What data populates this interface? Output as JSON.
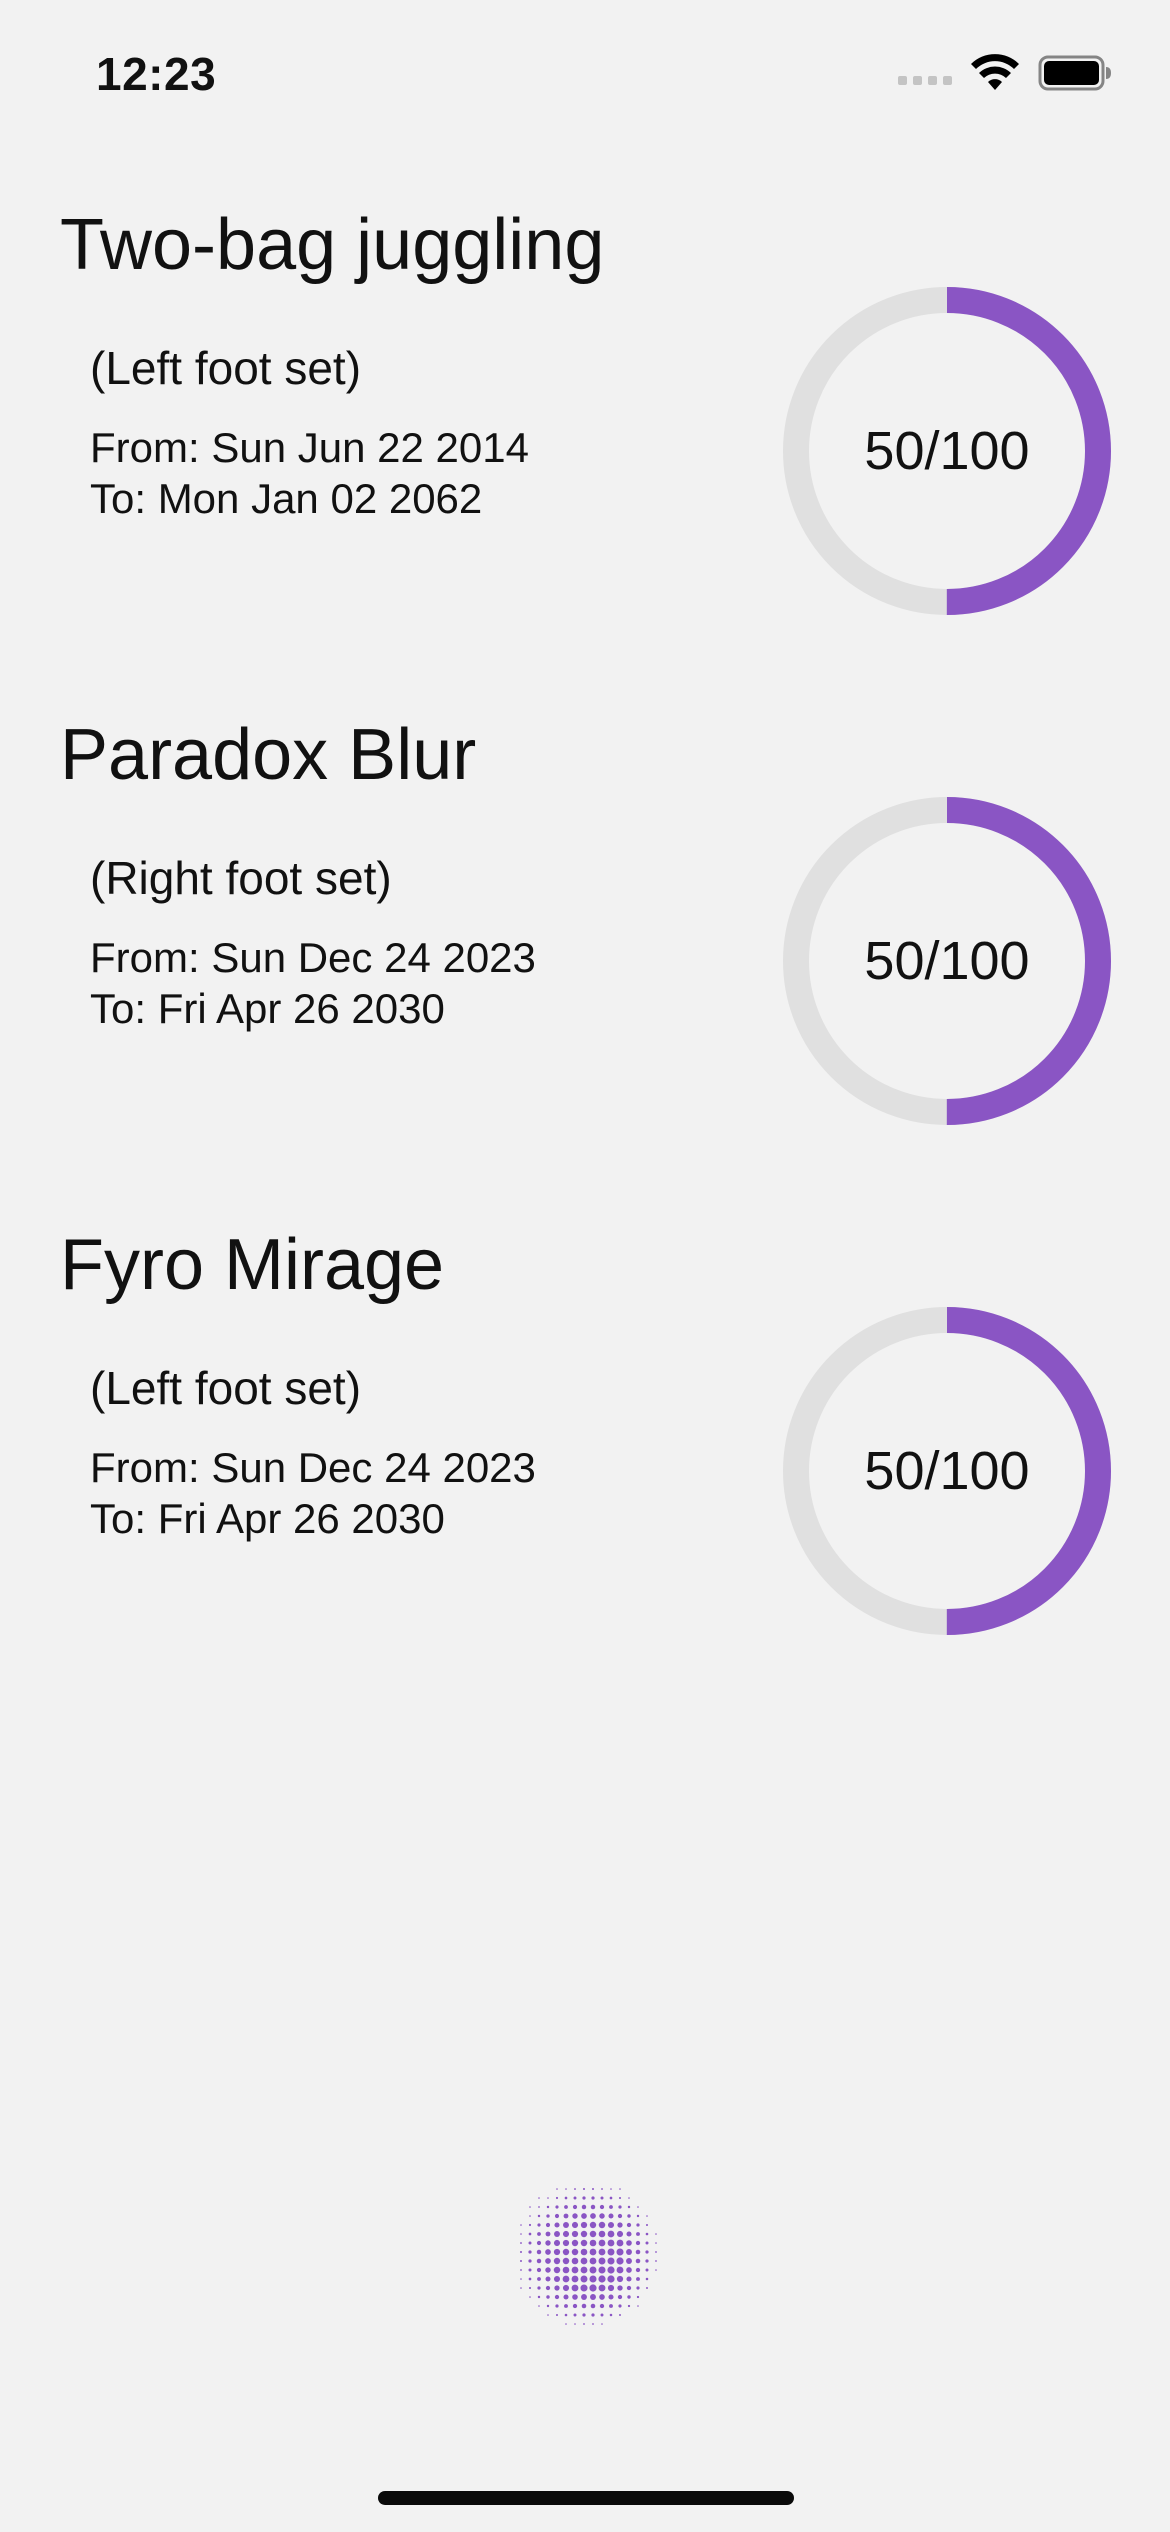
{
  "status_bar": {
    "time": "12:23",
    "icons": [
      "cellular-signal-icon",
      "wifi-icon",
      "battery-icon"
    ]
  },
  "colors": {
    "accent": "#8a55c4",
    "ring_track": "#e0e0e0",
    "background": "#f2f2f2"
  },
  "cards": [
    {
      "title": "Two-bag juggling",
      "subtitle": "(Left foot set)",
      "from": "From: Sun Jun 22 2014",
      "to": "To: Mon Jan 02 2062",
      "progress_label": "50/100",
      "progress": 0.5
    },
    {
      "title": "Paradox Blur",
      "subtitle": "(Right foot set)",
      "from": "From: Sun Dec 24 2023",
      "to": "To: Fri Apr 26 2030",
      "progress_label": "50/100",
      "progress": 0.5
    },
    {
      "title": "Fyro Mirage",
      "subtitle": "(Left foot set)",
      "from": "From: Sun Dec 24 2023",
      "to": "To: Fri Apr 26 2030",
      "progress_label": "50/100",
      "progress": 0.5
    }
  ],
  "fab": {
    "icon": "halftone-sphere-icon"
  }
}
